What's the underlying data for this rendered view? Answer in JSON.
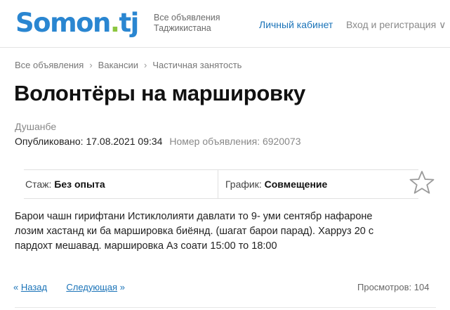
{
  "header": {
    "logo_part1": "Somon",
    "logo_dot": ".",
    "logo_part2": "tj",
    "tagline_line1": "Все объявления",
    "tagline_line2": "Таджикистана",
    "account_link": "Личный кабинет",
    "login_link": "Вход и регистрация",
    "login_suffix": "∨"
  },
  "breadcrumb": {
    "items": [
      "Все объявления",
      "Вакансии",
      "Частичная занятость"
    ],
    "separator": "›"
  },
  "listing": {
    "title": "Волонтёры на маршировку",
    "city": "Душанбе",
    "published_label": "Опубликовано:",
    "published_value": "17.08.2021 09:34",
    "number_label": "Номер объявления:",
    "number_value": "6920073",
    "specs": [
      {
        "label": "Стаж:",
        "value": "Без опыта"
      },
      {
        "label": "График:",
        "value": "Совмещение"
      }
    ],
    "description_lines": [
      "Барои чашн гирифтани Истиклолияти давлати то 9- уми сентябр нафароне",
      "лозим хастанд ки ба маршировка биёянд. (шагат барои парад). Харруз 20 с",
      "пардохт мешавад. маршировка Аз соати 15:00 то 18:00"
    ]
  },
  "pager": {
    "prev_arrow": "«",
    "prev_label": "Назад",
    "next_label": "Следующая",
    "next_arrow": "»"
  },
  "views": {
    "label": "Просмотров:",
    "value": "104"
  },
  "colors": {
    "logo_blue": "#2a86d1",
    "logo_green": "#8cc63f",
    "link": "#1a73b8"
  },
  "icons": {
    "favorite": "star-outline-icon"
  }
}
